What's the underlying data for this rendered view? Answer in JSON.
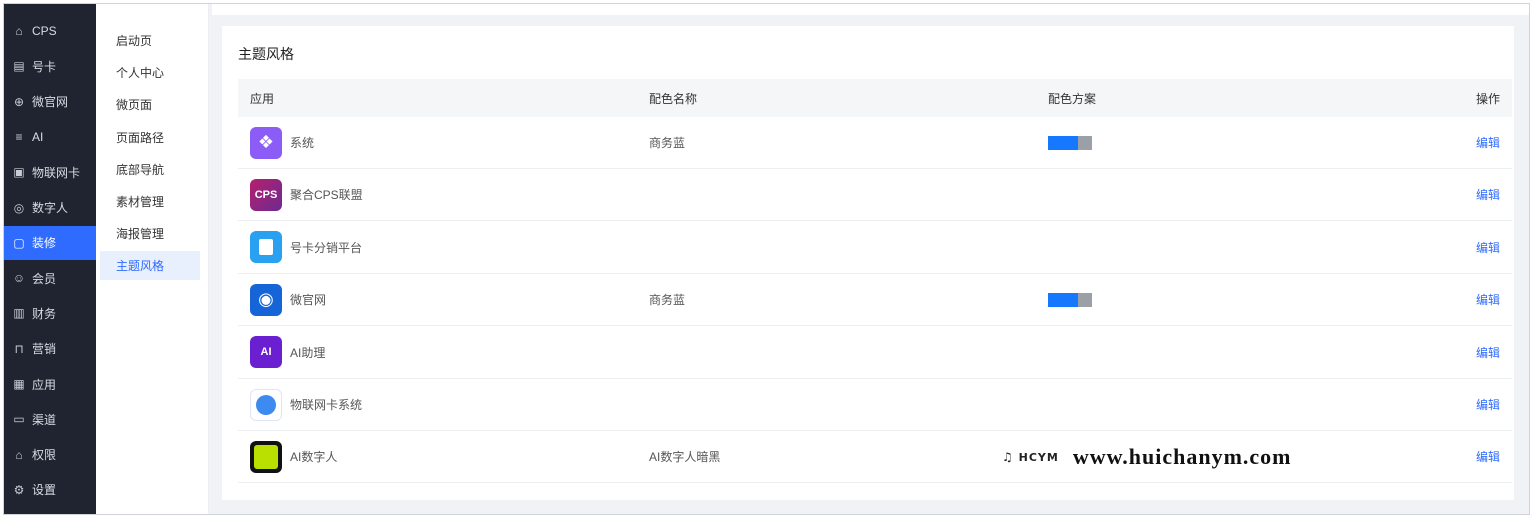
{
  "sidebar": {
    "items": [
      {
        "label": "CPS",
        "icon": "home-icon"
      },
      {
        "label": "号卡",
        "icon": "card-icon"
      },
      {
        "label": "微官网",
        "icon": "globe-icon"
      },
      {
        "label": "AI",
        "icon": "layers-icon"
      },
      {
        "label": "物联网卡",
        "icon": "chip-icon"
      },
      {
        "label": "数字人",
        "icon": "user-circle-icon"
      },
      {
        "label": "装修",
        "icon": "paint-icon"
      },
      {
        "label": "会员",
        "icon": "member-icon"
      },
      {
        "label": "财务",
        "icon": "wallet-icon"
      },
      {
        "label": "营销",
        "icon": "gift-icon"
      },
      {
        "label": "应用",
        "icon": "grid-icon"
      },
      {
        "label": "渠道",
        "icon": "monitor-icon"
      },
      {
        "label": "权限",
        "icon": "lock-icon"
      },
      {
        "label": "设置",
        "icon": "gear-icon"
      }
    ],
    "active": "装修"
  },
  "submenu": {
    "items": [
      "启动页",
      "个人中心",
      "微页面",
      "页面路径",
      "底部导航",
      "素材管理",
      "海报管理",
      "主题风格"
    ],
    "active": "主题风格"
  },
  "main": {
    "title": "主题风格",
    "columns": {
      "app": "应用",
      "name": "配色名称",
      "scheme": "配色方案",
      "op": "操作"
    },
    "rows": [
      {
        "app": "系统",
        "name": "商务蓝",
        "scheme": {
          "primary": "#1677ff",
          "secondary": "#9aa0a6"
        },
        "op": "编辑",
        "icon": "puzzle-icon",
        "icon_text": ""
      },
      {
        "app": "聚合CPS联盟",
        "name": "",
        "scheme": null,
        "op": "编辑",
        "icon": "cps-icon",
        "icon_text": "CPS"
      },
      {
        "app": "号卡分销平台",
        "name": "",
        "scheme": null,
        "op": "编辑",
        "icon": "sim-icon",
        "icon_text": ""
      },
      {
        "app": "微官网",
        "name": "商务蓝",
        "scheme": {
          "primary": "#1677ff",
          "secondary": "#9aa0a6"
        },
        "op": "编辑",
        "icon": "globe-icon",
        "icon_text": ""
      },
      {
        "app": "AI助理",
        "name": "",
        "scheme": null,
        "op": "编辑",
        "icon": "ai-icon",
        "icon_text": "AI"
      },
      {
        "app": "物联网卡系统",
        "name": "",
        "scheme": null,
        "op": "编辑",
        "icon": "iot-icon",
        "icon_text": ""
      },
      {
        "app": "AI数字人",
        "name": "AI数字人暗黑",
        "scheme": null,
        "op": "编辑",
        "icon": "digital-human-icon",
        "icon_text": ""
      }
    ]
  },
  "watermark": {
    "logo": "HCYM",
    "url": "www.huichanym.com"
  },
  "colors": {
    "accent": "#2f6bff",
    "sidebar_bg": "#1f2430"
  }
}
